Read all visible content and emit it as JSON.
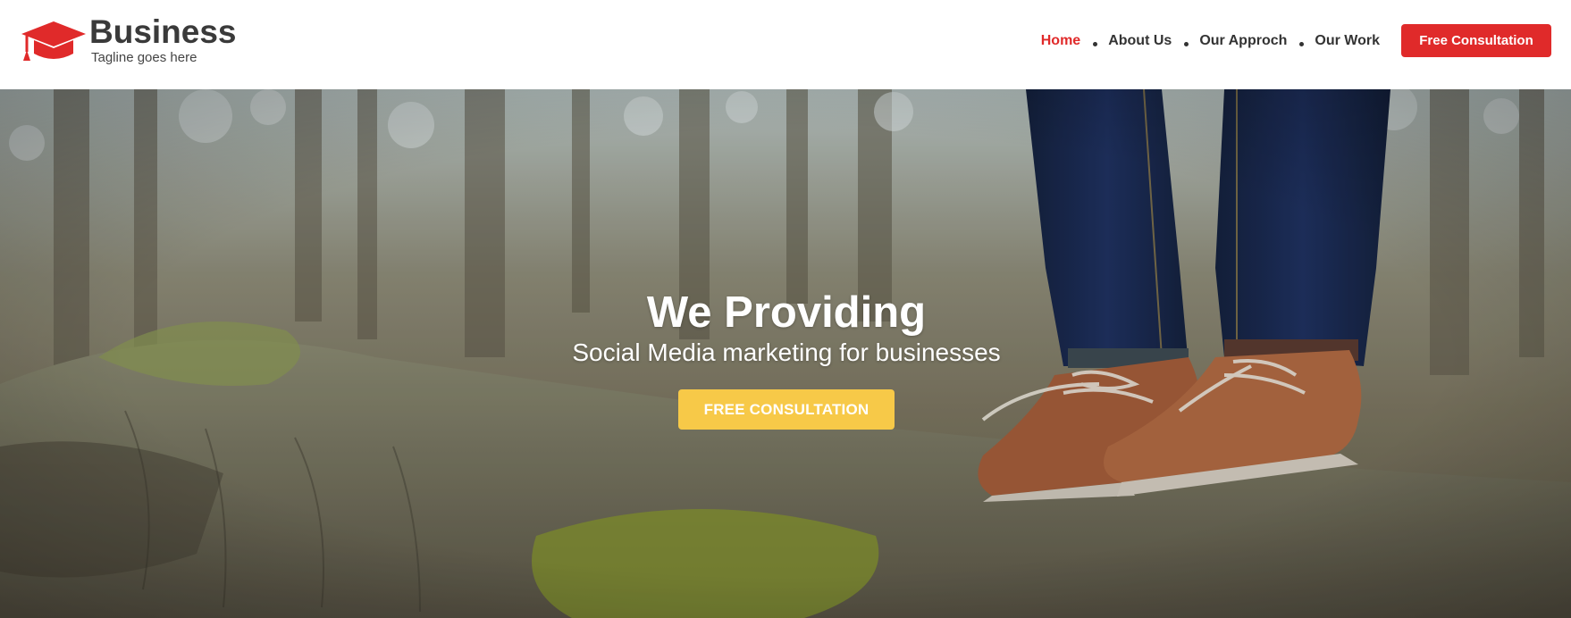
{
  "header": {
    "brand": "Business",
    "tagline": "Tagline goes here",
    "logo_icon": "graduation-cap-icon",
    "nav": [
      {
        "label": "Home",
        "active": true
      },
      {
        "label": "About Us",
        "active": false
      },
      {
        "label": "Our Approch",
        "active": false
      },
      {
        "label": "Our Work",
        "active": false
      }
    ],
    "cta_label": "Free Consultation"
  },
  "hero": {
    "title": "We Providing",
    "subtitle": "Social Media marketing for businesses",
    "button_label": "FREE CONSULTATION",
    "background": "photo of brown leather boots on a mossy log in a forest"
  },
  "colors": {
    "accent_red": "#e02a2a",
    "button_yellow": "#f7c948",
    "text_dark": "#333333"
  }
}
